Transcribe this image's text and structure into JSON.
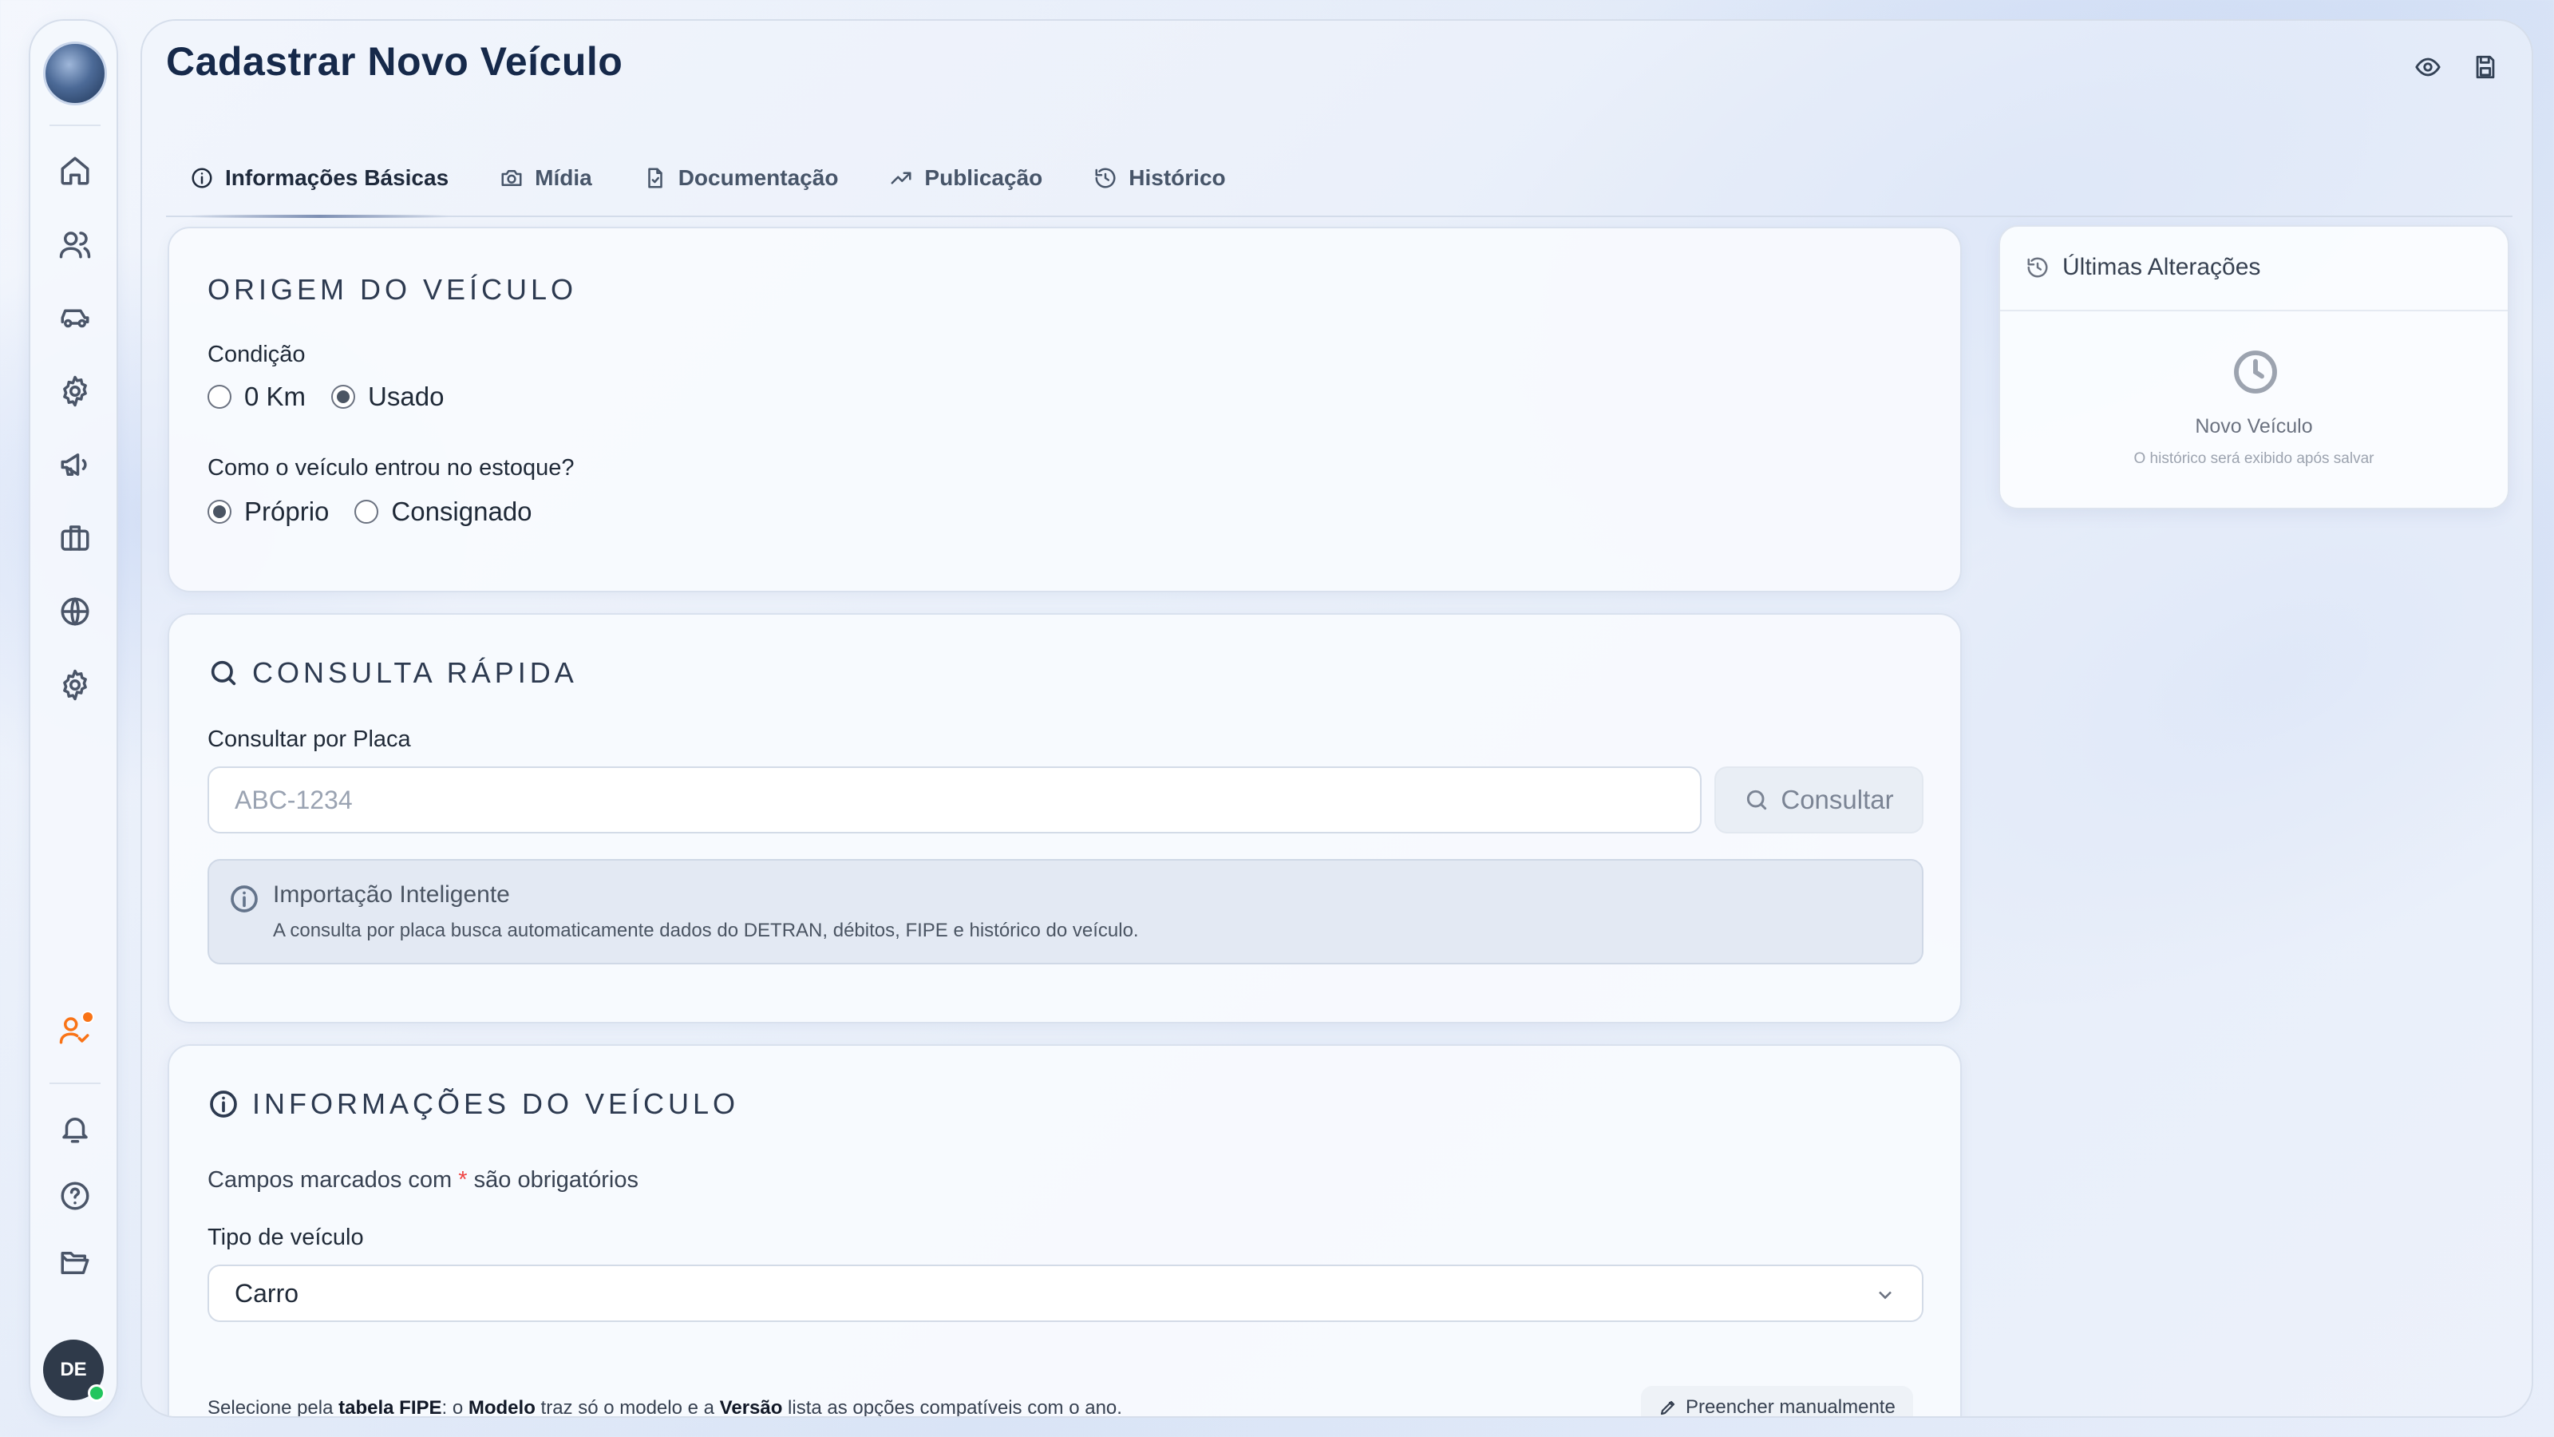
{
  "page": {
    "title": "Cadastrar Novo Veículo"
  },
  "tabs": [
    {
      "label": "Informações Básicas",
      "icon": "info-icon",
      "active": true
    },
    {
      "label": "Mídia",
      "icon": "camera-icon",
      "active": false
    },
    {
      "label": "Documentação",
      "icon": "document-icon",
      "active": false
    },
    {
      "label": "Publicação",
      "icon": "trending-up-icon",
      "active": false
    },
    {
      "label": "Histórico",
      "icon": "history-icon",
      "active": false
    }
  ],
  "origem": {
    "title": "ORIGEM DO VEÍCULO",
    "condicao_label": "Condição",
    "condicao_options": [
      {
        "label": "0 Km",
        "selected": false
      },
      {
        "label": "Usado",
        "selected": true
      }
    ],
    "entrada_label": "Como o veículo entrou no estoque?",
    "entrada_options": [
      {
        "label": "Próprio",
        "selected": true
      },
      {
        "label": "Consignado",
        "selected": false
      }
    ]
  },
  "consulta": {
    "title": "CONSULTA RÁPIDA",
    "placa_label": "Consultar por Placa",
    "placa_placeholder": "ABC-1234",
    "placa_value": "",
    "button_label": "Consultar",
    "info_title": "Importação Inteligente",
    "info_text": "A consulta por placa busca automaticamente dados do DETRAN, débitos, FIPE e histórico do veículo."
  },
  "informacoes": {
    "title": "INFORMAÇÕES DO VEÍCULO",
    "required_prefix": "Campos marcados com ",
    "required_star": "*",
    "required_suffix": " são obrigatórios",
    "tipo_label": "Tipo de veículo",
    "tipo_value": "Carro",
    "fipe_part1": "Selecione pela ",
    "fipe_bold1": "tabela FIPE",
    "fipe_part2": ": o ",
    "fipe_bold2": "Modelo",
    "fipe_part3": " traz só o modelo e a ",
    "fipe_bold3": "Versão",
    "fipe_part4": " lista as opções compatíveis com o ano.",
    "manual_button": "Preencher manualmente"
  },
  "historico_panel": {
    "title": "Últimas Alterações",
    "empty_title": "Novo Veículo",
    "empty_subtitle": "O histórico será exibido após salvar"
  },
  "user": {
    "initials": "DE",
    "status_color": "#22c55e"
  },
  "colors": {
    "accent_orange": "#f97316",
    "required_red": "#ef4444",
    "title_navy": "#16294a"
  }
}
